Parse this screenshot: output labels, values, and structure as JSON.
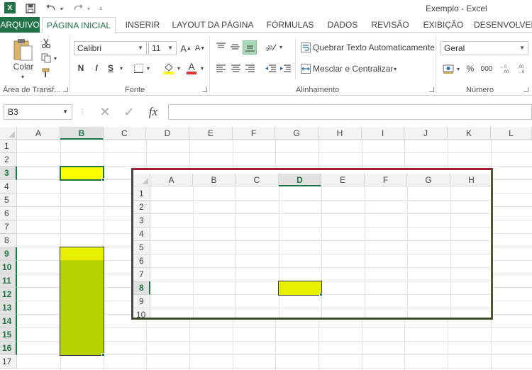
{
  "window": {
    "title": "Exemplo - Excel",
    "app_icon_letter": "X",
    "accent": "#217346"
  },
  "quick_access": {
    "save_icon": "save-icon",
    "undo_icon": "undo-icon",
    "redo_icon": "redo-icon",
    "customize_icon": "customize-icon"
  },
  "tabs": [
    {
      "label": "ARQUIVO"
    },
    {
      "label": "PÁGINA INICIAL"
    },
    {
      "label": "INSERIR"
    },
    {
      "label": "LAYOUT DA PÁGINA"
    },
    {
      "label": "FÓRMULAS"
    },
    {
      "label": "DADOS"
    },
    {
      "label": "REVISÃO"
    },
    {
      "label": "EXIBIÇÃO"
    },
    {
      "label": "DESENVOLVED"
    }
  ],
  "ribbon": {
    "clipboard": {
      "paste_label": "Colar",
      "group_label": "Área de Transf..."
    },
    "font": {
      "font_name": "Calibri",
      "font_size": "11",
      "bold": "N",
      "italic": "I",
      "underline": "S",
      "grow": "A",
      "shrink": "A",
      "font_color_letter": "A",
      "group_label": "Fonte",
      "highlight_color": "#ffff00",
      "font_color": "#e03030"
    },
    "alignment": {
      "wrap_text": "Quebrar Texto Automaticamente",
      "merge_center": "Mesclar e Centralizar",
      "group_label": "Alinhamento"
    },
    "number": {
      "format": "Geral",
      "percent": "%",
      "thousands": "000",
      "dec_more": "⁰⁰ ₀",
      "dec_less": ",00",
      "group_label": "Número"
    }
  },
  "formula_bar": {
    "name_box": "B3",
    "cancel": "✕",
    "enter": "✓",
    "fx": "fx",
    "formula": ""
  },
  "sheet": {
    "columns": [
      "A",
      "B",
      "C",
      "D",
      "E",
      "F",
      "G",
      "H",
      "I",
      "J",
      "K",
      "L"
    ],
    "rows": [
      "1",
      "2",
      "3",
      "4",
      "5",
      "6",
      "7",
      "8",
      "9",
      "10",
      "11",
      "12",
      "13",
      "14",
      "15",
      "16",
      "17"
    ],
    "selected_column": "B",
    "selected_rows": [
      "3",
      "9",
      "10",
      "11",
      "12",
      "13",
      "14",
      "15",
      "16"
    ],
    "active_cell_fill": "#ffff00",
    "range_top_fill": "#e8f000",
    "range_fill": "#b4d300"
  },
  "embedded_sheet": {
    "columns": [
      "A",
      "B",
      "C",
      "D",
      "E",
      "F",
      "G",
      "H"
    ],
    "rows": [
      "1",
      "2",
      "3",
      "4",
      "5",
      "6",
      "7",
      "8",
      "9",
      "10"
    ],
    "selected_column": "D",
    "selected_row": "8",
    "active_cell_fill": "#e8f000"
  }
}
